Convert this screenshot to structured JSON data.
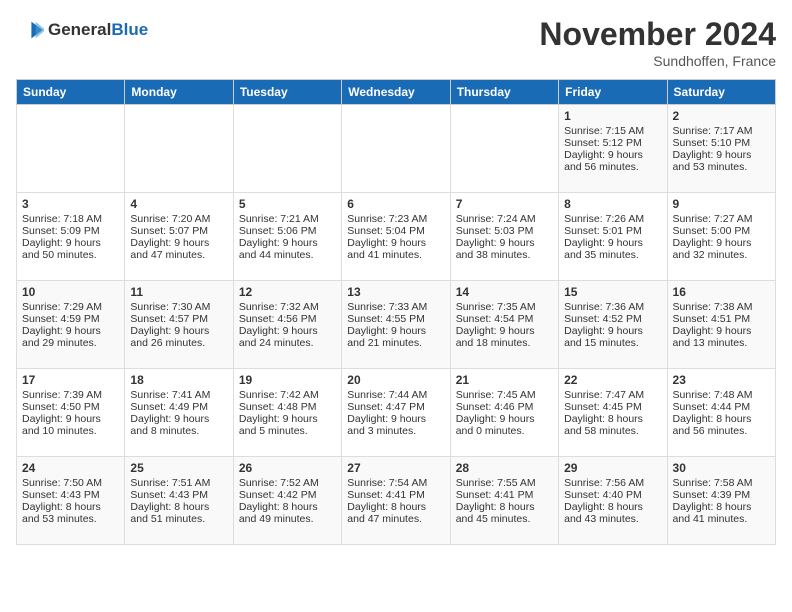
{
  "header": {
    "logo_general": "General",
    "logo_blue": "Blue",
    "month_title": "November 2024",
    "location": "Sundhoffen, France"
  },
  "calendar": {
    "days_of_week": [
      "Sunday",
      "Monday",
      "Tuesday",
      "Wednesday",
      "Thursday",
      "Friday",
      "Saturday"
    ],
    "weeks": [
      [
        {
          "day": "",
          "info": ""
        },
        {
          "day": "",
          "info": ""
        },
        {
          "day": "",
          "info": ""
        },
        {
          "day": "",
          "info": ""
        },
        {
          "day": "",
          "info": ""
        },
        {
          "day": "1",
          "info": "Sunrise: 7:15 AM\nSunset: 5:12 PM\nDaylight: 9 hours and 56 minutes."
        },
        {
          "day": "2",
          "info": "Sunrise: 7:17 AM\nSunset: 5:10 PM\nDaylight: 9 hours and 53 minutes."
        }
      ],
      [
        {
          "day": "3",
          "info": "Sunrise: 7:18 AM\nSunset: 5:09 PM\nDaylight: 9 hours and 50 minutes."
        },
        {
          "day": "4",
          "info": "Sunrise: 7:20 AM\nSunset: 5:07 PM\nDaylight: 9 hours and 47 minutes."
        },
        {
          "day": "5",
          "info": "Sunrise: 7:21 AM\nSunset: 5:06 PM\nDaylight: 9 hours and 44 minutes."
        },
        {
          "day": "6",
          "info": "Sunrise: 7:23 AM\nSunset: 5:04 PM\nDaylight: 9 hours and 41 minutes."
        },
        {
          "day": "7",
          "info": "Sunrise: 7:24 AM\nSunset: 5:03 PM\nDaylight: 9 hours and 38 minutes."
        },
        {
          "day": "8",
          "info": "Sunrise: 7:26 AM\nSunset: 5:01 PM\nDaylight: 9 hours and 35 minutes."
        },
        {
          "day": "9",
          "info": "Sunrise: 7:27 AM\nSunset: 5:00 PM\nDaylight: 9 hours and 32 minutes."
        }
      ],
      [
        {
          "day": "10",
          "info": "Sunrise: 7:29 AM\nSunset: 4:59 PM\nDaylight: 9 hours and 29 minutes."
        },
        {
          "day": "11",
          "info": "Sunrise: 7:30 AM\nSunset: 4:57 PM\nDaylight: 9 hours and 26 minutes."
        },
        {
          "day": "12",
          "info": "Sunrise: 7:32 AM\nSunset: 4:56 PM\nDaylight: 9 hours and 24 minutes."
        },
        {
          "day": "13",
          "info": "Sunrise: 7:33 AM\nSunset: 4:55 PM\nDaylight: 9 hours and 21 minutes."
        },
        {
          "day": "14",
          "info": "Sunrise: 7:35 AM\nSunset: 4:54 PM\nDaylight: 9 hours and 18 minutes."
        },
        {
          "day": "15",
          "info": "Sunrise: 7:36 AM\nSunset: 4:52 PM\nDaylight: 9 hours and 15 minutes."
        },
        {
          "day": "16",
          "info": "Sunrise: 7:38 AM\nSunset: 4:51 PM\nDaylight: 9 hours and 13 minutes."
        }
      ],
      [
        {
          "day": "17",
          "info": "Sunrise: 7:39 AM\nSunset: 4:50 PM\nDaylight: 9 hours and 10 minutes."
        },
        {
          "day": "18",
          "info": "Sunrise: 7:41 AM\nSunset: 4:49 PM\nDaylight: 9 hours and 8 minutes."
        },
        {
          "day": "19",
          "info": "Sunrise: 7:42 AM\nSunset: 4:48 PM\nDaylight: 9 hours and 5 minutes."
        },
        {
          "day": "20",
          "info": "Sunrise: 7:44 AM\nSunset: 4:47 PM\nDaylight: 9 hours and 3 minutes."
        },
        {
          "day": "21",
          "info": "Sunrise: 7:45 AM\nSunset: 4:46 PM\nDaylight: 9 hours and 0 minutes."
        },
        {
          "day": "22",
          "info": "Sunrise: 7:47 AM\nSunset: 4:45 PM\nDaylight: 8 hours and 58 minutes."
        },
        {
          "day": "23",
          "info": "Sunrise: 7:48 AM\nSunset: 4:44 PM\nDaylight: 8 hours and 56 minutes."
        }
      ],
      [
        {
          "day": "24",
          "info": "Sunrise: 7:50 AM\nSunset: 4:43 PM\nDaylight: 8 hours and 53 minutes."
        },
        {
          "day": "25",
          "info": "Sunrise: 7:51 AM\nSunset: 4:43 PM\nDaylight: 8 hours and 51 minutes."
        },
        {
          "day": "26",
          "info": "Sunrise: 7:52 AM\nSunset: 4:42 PM\nDaylight: 8 hours and 49 minutes."
        },
        {
          "day": "27",
          "info": "Sunrise: 7:54 AM\nSunset: 4:41 PM\nDaylight: 8 hours and 47 minutes."
        },
        {
          "day": "28",
          "info": "Sunrise: 7:55 AM\nSunset: 4:41 PM\nDaylight: 8 hours and 45 minutes."
        },
        {
          "day": "29",
          "info": "Sunrise: 7:56 AM\nSunset: 4:40 PM\nDaylight: 8 hours and 43 minutes."
        },
        {
          "day": "30",
          "info": "Sunrise: 7:58 AM\nSunset: 4:39 PM\nDaylight: 8 hours and 41 minutes."
        }
      ]
    ]
  }
}
